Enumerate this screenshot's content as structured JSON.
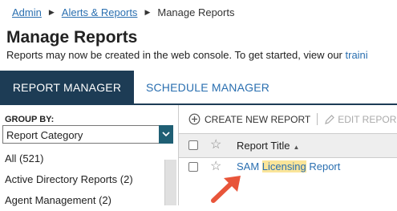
{
  "breadcrumb": {
    "admin": "Admin",
    "alerts_reports": "Alerts & Reports",
    "current": "Manage Reports"
  },
  "page": {
    "title": "Manage Reports",
    "subtitle": "Reports may now be created in the web console. To get started, view our ",
    "subtitle_link": "traini"
  },
  "tabs": {
    "report_manager": "REPORT MANAGER",
    "schedule_manager": "SCHEDULE MANAGER"
  },
  "group_by": {
    "label": "GROUP BY:",
    "selected": "Report Category"
  },
  "categories": [
    "All (521)",
    "Active Directory Reports (2)",
    "Agent Management (2)"
  ],
  "toolbar": {
    "create": "CREATE NEW REPORT",
    "edit": "EDIT REPOR"
  },
  "table": {
    "column_title": "Report Title"
  },
  "report_row": {
    "before": "SAM ",
    "highlight": "Licensing",
    "after": " Report"
  },
  "colors": {
    "tab_active_bg": "#1d3c55",
    "link": "#2a6fb0",
    "highlight": "#fae59a",
    "arrow": "#e8553a"
  }
}
